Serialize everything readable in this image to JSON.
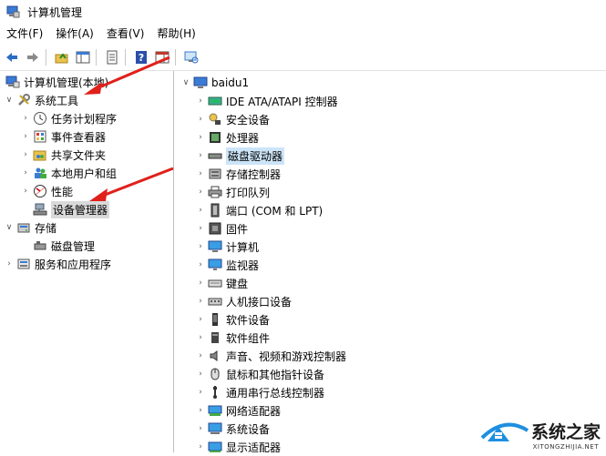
{
  "window": {
    "title": "计算机管理"
  },
  "menu": [
    "文件(F)",
    "操作(A)",
    "查看(V)",
    "帮助(H)"
  ],
  "tree": {
    "root": "计算机管理(本地)",
    "system_tools": "系统工具",
    "task_scheduler": "任务计划程序",
    "event_viewer": "事件查看器",
    "shared_folders": "共享文件夹",
    "local_users": "本地用户和组",
    "performance": "性能",
    "device_manager": "设备管理器",
    "storage": "存储",
    "disk_management": "磁盘管理",
    "services_apps": "服务和应用程序"
  },
  "devices": {
    "computer_name": "baidu1",
    "items": [
      {
        "label": "IDE ATA/ATAPI 控制器",
        "icon": "ide-controller-icon"
      },
      {
        "label": "安全设备",
        "icon": "security-device-icon"
      },
      {
        "label": "处理器",
        "icon": "processor-icon"
      },
      {
        "label": "磁盘驱动器",
        "icon": "disk-drive-icon"
      },
      {
        "label": "存储控制器",
        "icon": "storage-controller-icon"
      },
      {
        "label": "打印队列",
        "icon": "printer-icon"
      },
      {
        "label": "端口 (COM 和 LPT)",
        "icon": "port-icon"
      },
      {
        "label": "固件",
        "icon": "firmware-icon"
      },
      {
        "label": "计算机",
        "icon": "computer-icon"
      },
      {
        "label": "监视器",
        "icon": "monitor-icon"
      },
      {
        "label": "键盘",
        "icon": "keyboard-icon"
      },
      {
        "label": "人机接口设备",
        "icon": "hid-icon"
      },
      {
        "label": "软件设备",
        "icon": "software-device-icon"
      },
      {
        "label": "软件组件",
        "icon": "software-component-icon"
      },
      {
        "label": "声音、视频和游戏控制器",
        "icon": "sound-icon"
      },
      {
        "label": "鼠标和其他指针设备",
        "icon": "mouse-icon"
      },
      {
        "label": "通用串行总线控制器",
        "icon": "usb-icon"
      },
      {
        "label": "网络适配器",
        "icon": "network-adapter-icon"
      },
      {
        "label": "系统设备",
        "icon": "system-device-icon"
      },
      {
        "label": "显示适配器",
        "icon": "display-adapter-icon"
      }
    ]
  },
  "watermark": {
    "text": "系统之家",
    "sub": "XITONGZHIJIA.NET"
  },
  "colors": {
    "arrow": "#e0201b",
    "selection": "#cce4f7"
  }
}
